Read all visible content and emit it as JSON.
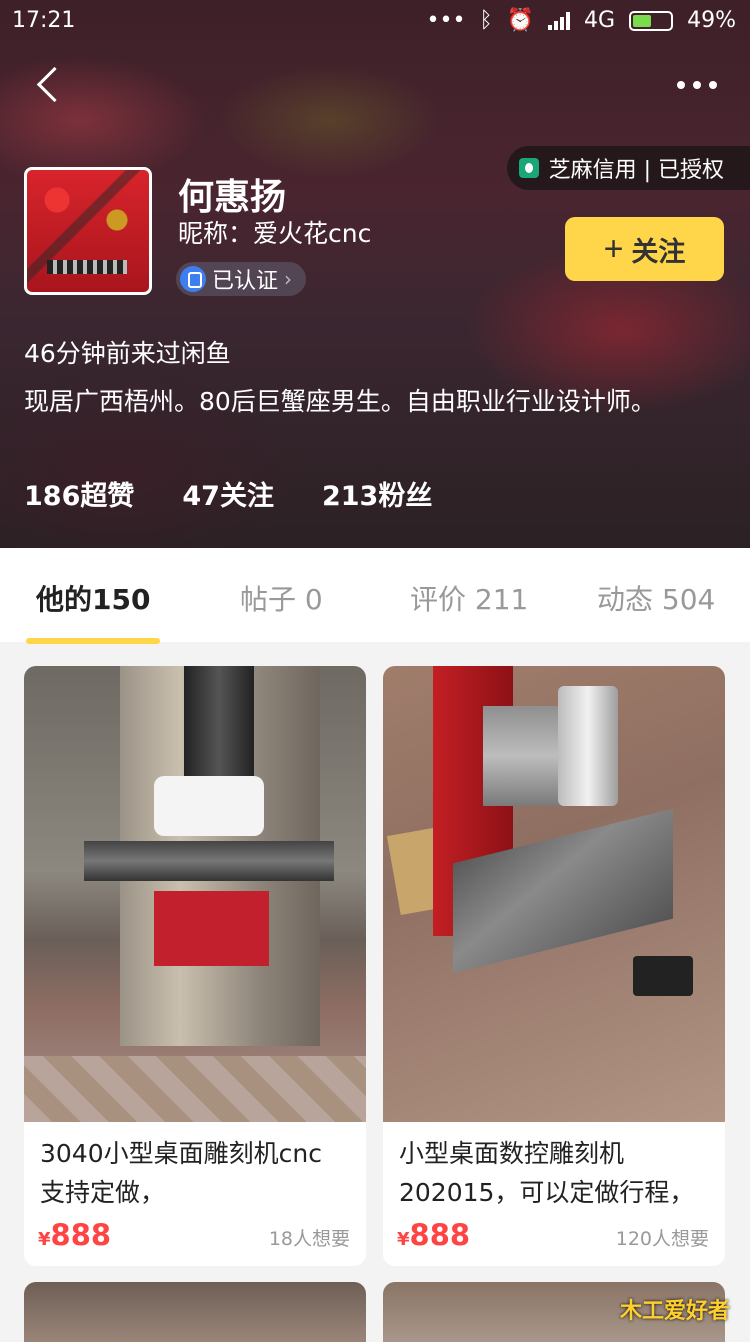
{
  "status_bar": {
    "time": "17:21",
    "network": "4G",
    "battery": "49%"
  },
  "header": {
    "back_icon": "back-arrow-icon",
    "more_icon": "more-icon"
  },
  "credit": {
    "label": "芝麻信用 | 已授权"
  },
  "profile": {
    "name": "何惠扬",
    "nickname": "昵称：爱火花cnc",
    "verified_label": "已认证",
    "follow_label": "关注",
    "last_seen": "46分钟前来过闲鱼",
    "bio": "现居广西梧州。80后巨蟹座男生。自由职业行业设计师。"
  },
  "stats": [
    {
      "label": "186超赞"
    },
    {
      "label": "47关注"
    },
    {
      "label": "213粉丝"
    }
  ],
  "tabs": [
    {
      "label": "他的150",
      "active": true
    },
    {
      "label": "帖子 0",
      "active": false
    },
    {
      "label": "评价 211",
      "active": false
    },
    {
      "label": "动态 504",
      "active": false
    }
  ],
  "items": [
    {
      "title_line1": "3040小型桌面雕刻机cnc",
      "title_line2": "支持定做，",
      "currency": "¥",
      "price": "888",
      "wants": "18人想要"
    },
    {
      "title_line1": "小型桌面数控雕刻机",
      "title_line2": "202015，可以定做行程，",
      "currency": "¥",
      "price": "888",
      "wants": "120人想要"
    }
  ],
  "watermark": "木工爱好者",
  "colors": {
    "accent": "#ffd64a",
    "price": "#ff4444"
  }
}
